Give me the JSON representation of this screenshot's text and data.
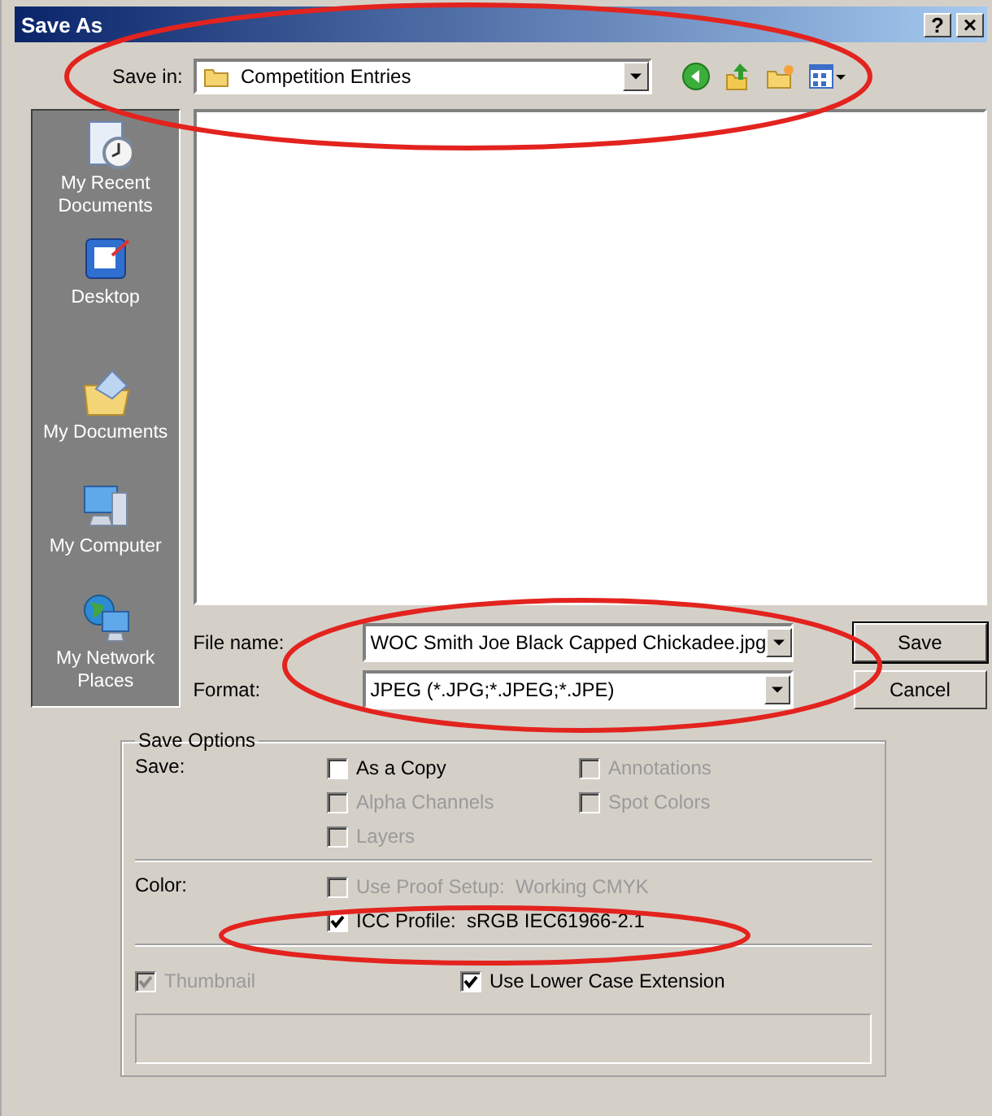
{
  "window": {
    "title": "Save As",
    "buttons": [
      {
        "kind": "help",
        "label": "?"
      },
      {
        "kind": "close",
        "label": "×"
      }
    ]
  },
  "save_in": {
    "label": "Save in:",
    "value": "Competition Entries"
  },
  "toolbar": [
    {
      "kind": "back"
    },
    {
      "kind": "up"
    },
    {
      "kind": "new-folder"
    },
    {
      "kind": "views"
    }
  ],
  "places": [
    {
      "label": "My Recent Documents",
      "kind": "recent"
    },
    {
      "label": "Desktop",
      "kind": "desktop"
    },
    {
      "label": "My Documents",
      "kind": "documents"
    },
    {
      "label": "My Computer",
      "kind": "computer"
    },
    {
      "label": "My Network Places",
      "kind": "network"
    }
  ],
  "file_name": {
    "label": "File name:",
    "value": "WOC Smith Joe Black Capped Chickadee.jpg"
  },
  "format": {
    "label": "Format:",
    "value": "JPEG (*.JPG;*.JPEG;*.JPE)"
  },
  "buttons": [
    {
      "label": "Save",
      "default": true
    },
    {
      "label": "Cancel",
      "default": false
    }
  ],
  "save_options": {
    "title": "Save Options",
    "sections": [
      {
        "label": "Save:",
        "kind": "grid",
        "options": [
          {
            "label": "As a Copy",
            "checked": false,
            "disabled": false
          },
          {
            "label": "Annotations",
            "checked": false,
            "disabled": true
          },
          {
            "label": "Alpha Channels",
            "checked": false,
            "disabled": true
          },
          {
            "label": "Spot Colors",
            "checked": false,
            "disabled": true
          },
          {
            "label": "Layers",
            "checked": false,
            "disabled": true
          }
        ]
      },
      {
        "label": "Color:",
        "kind": "list",
        "options": [
          {
            "label": "Use Proof Setup:  Working CMYK",
            "checked": false,
            "disabled": true
          },
          {
            "label": "ICC Profile:  sRGB IEC61966-2.1",
            "checked": true,
            "disabled": false
          }
        ]
      }
    ],
    "footer_options": [
      {
        "label": "Thumbnail",
        "checked": true,
        "disabled": true
      },
      {
        "label": "Use Lower Case Extension",
        "checked": true,
        "disabled": false
      }
    ]
  },
  "annotations": [
    {
      "kind": "ellipse"
    },
    {
      "kind": "ellipse"
    },
    {
      "kind": "ellipse"
    }
  ]
}
